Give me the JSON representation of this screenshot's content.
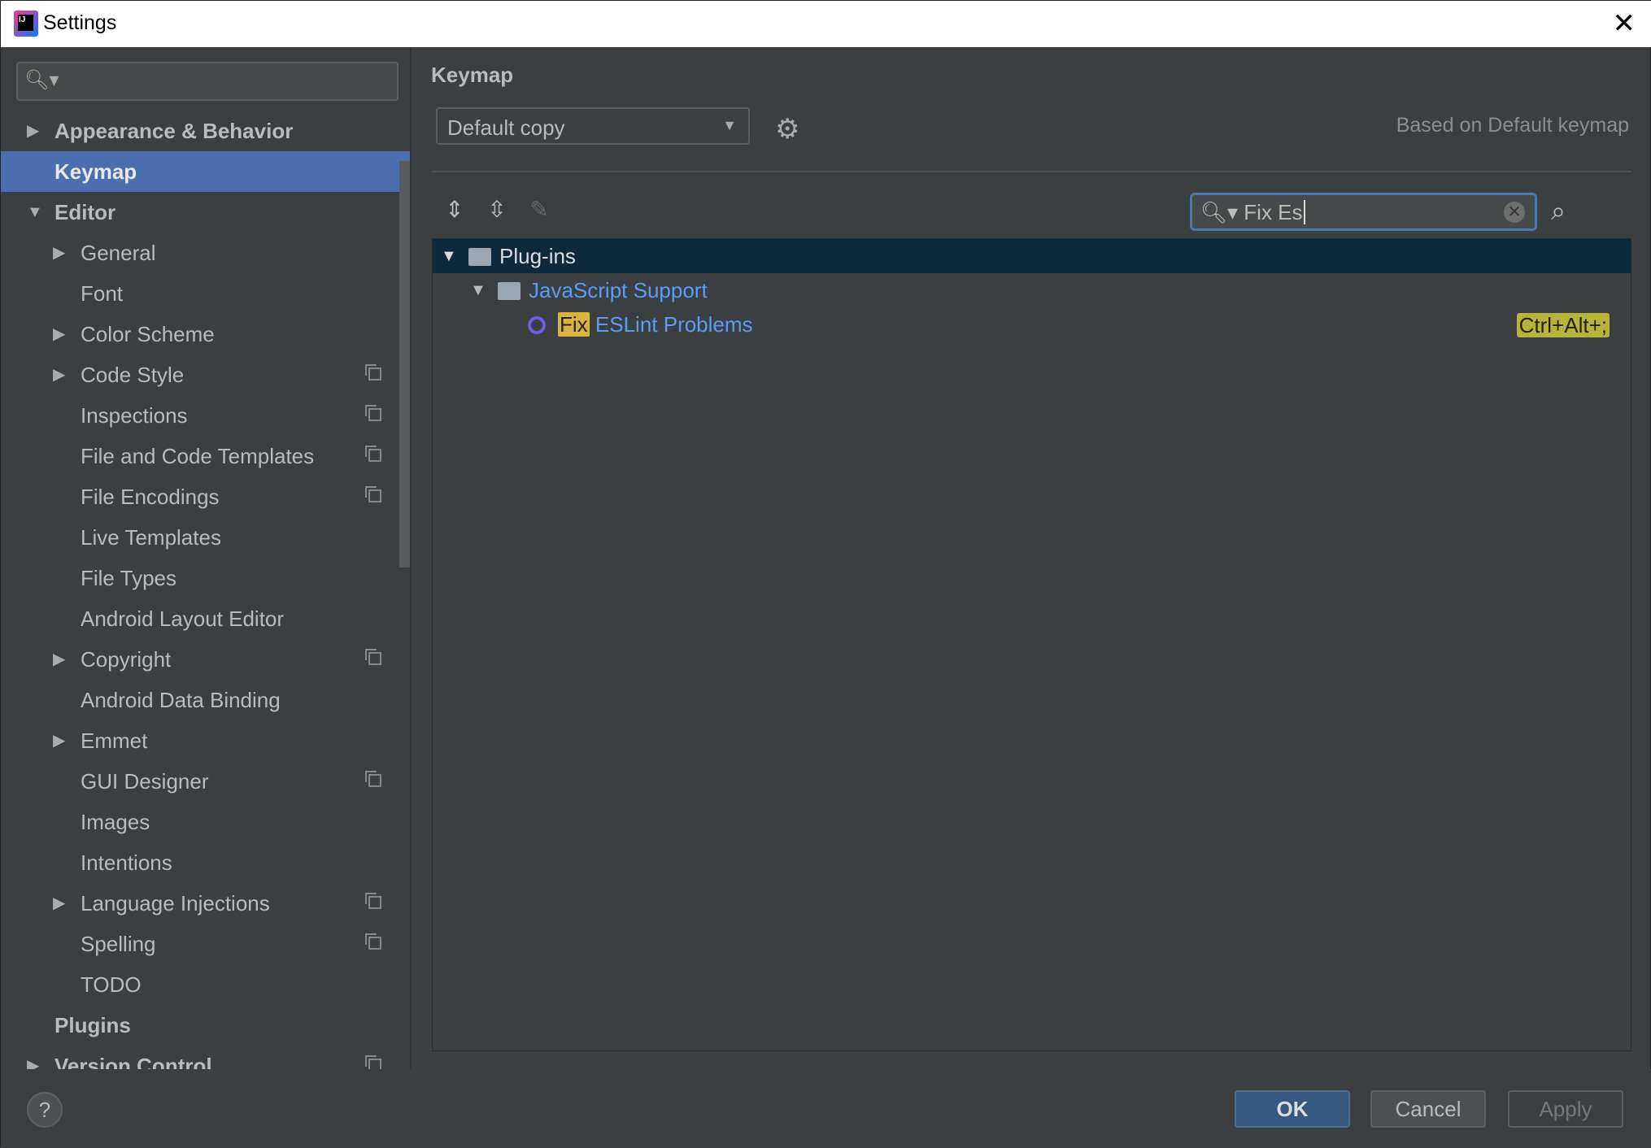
{
  "window": {
    "title": "Settings"
  },
  "sidebar": {
    "search_placeholder": "",
    "items": [
      {
        "label": "Appearance & Behavior",
        "level": 0,
        "arrow": "collapsed",
        "bold": true
      },
      {
        "label": "Keymap",
        "level": 0,
        "arrow": "none",
        "bold": true,
        "selected": true
      },
      {
        "label": "Editor",
        "level": 0,
        "arrow": "expanded",
        "bold": true
      },
      {
        "label": "General",
        "level": 1,
        "arrow": "collapsed"
      },
      {
        "label": "Font",
        "level": 1,
        "arrow": "none"
      },
      {
        "label": "Color Scheme",
        "level": 1,
        "arrow": "collapsed"
      },
      {
        "label": "Code Style",
        "level": 1,
        "arrow": "collapsed",
        "copy": true
      },
      {
        "label": "Inspections",
        "level": 1,
        "arrow": "none",
        "copy": true
      },
      {
        "label": "File and Code Templates",
        "level": 1,
        "arrow": "none",
        "copy": true
      },
      {
        "label": "File Encodings",
        "level": 1,
        "arrow": "none",
        "copy": true
      },
      {
        "label": "Live Templates",
        "level": 1,
        "arrow": "none"
      },
      {
        "label": "File Types",
        "level": 1,
        "arrow": "none"
      },
      {
        "label": "Android Layout Editor",
        "level": 1,
        "arrow": "none"
      },
      {
        "label": "Copyright",
        "level": 1,
        "arrow": "collapsed",
        "copy": true
      },
      {
        "label": "Android Data Binding",
        "level": 1,
        "arrow": "none"
      },
      {
        "label": "Emmet",
        "level": 1,
        "arrow": "collapsed"
      },
      {
        "label": "GUI Designer",
        "level": 1,
        "arrow": "none",
        "copy": true
      },
      {
        "label": "Images",
        "level": 1,
        "arrow": "none"
      },
      {
        "label": "Intentions",
        "level": 1,
        "arrow": "none"
      },
      {
        "label": "Language Injections",
        "level": 1,
        "arrow": "collapsed",
        "copy": true
      },
      {
        "label": "Spelling",
        "level": 1,
        "arrow": "none",
        "copy": true
      },
      {
        "label": "TODO",
        "level": 1,
        "arrow": "none"
      },
      {
        "label": "Plugins",
        "level": 0,
        "arrow": "none",
        "bold": true
      },
      {
        "label": "Version Control",
        "level": 0,
        "arrow": "collapsed",
        "bold": true,
        "copy": true
      }
    ]
  },
  "main": {
    "title": "Keymap",
    "keymap_select": "Default copy",
    "based_on": "Based on Default keymap",
    "search_value": "Fix Es",
    "tree": {
      "group": "Plug-ins",
      "subgroup": "JavaScript Support",
      "action_match": "Fix",
      "action_rest": " ESLint Problems",
      "shortcut": "Ctrl+Alt+;"
    }
  },
  "buttons": {
    "ok": "OK",
    "cancel": "Cancel",
    "apply": "Apply",
    "help": "?"
  },
  "colors": {
    "selection": "#4b6eaf",
    "tree_selection": "#0d293e",
    "link": "#589df6",
    "highlight": "#d9b341"
  }
}
